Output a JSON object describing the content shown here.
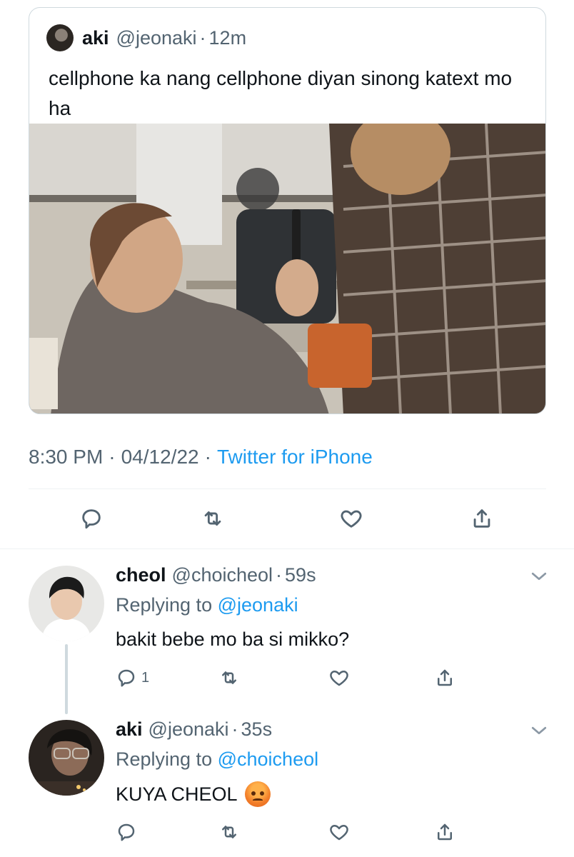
{
  "quoted_tweet": {
    "display_name": "aki",
    "handle": "@jeonaki",
    "separator": "·",
    "time": "12m",
    "text": "cellphone ka nang cellphone diyan sinong katext mo ha"
  },
  "tweet_meta": {
    "time": "8:30 PM",
    "sep1": "·",
    "date": "04/12/22",
    "sep2": "·",
    "client": "Twitter for iPhone"
  },
  "replies": [
    {
      "display_name": "cheol",
      "handle": "@choicheol",
      "separator": "·",
      "time": "59s",
      "replying_prefix": "Replying to",
      "replying_to": "@jeonaki",
      "text": "bakit bebe mo ba si mikko?",
      "reply_count": "1"
    },
    {
      "display_name": "aki",
      "handle": "@jeonaki",
      "separator": "·",
      "time": "35s",
      "replying_prefix": "Replying to",
      "replying_to": "@choicheol",
      "text": "KUYA CHEOL",
      "emoji": "angry-face"
    }
  ],
  "colors": {
    "link": "#1d9bf0",
    "muted": "#536471",
    "text": "#0f1419"
  }
}
